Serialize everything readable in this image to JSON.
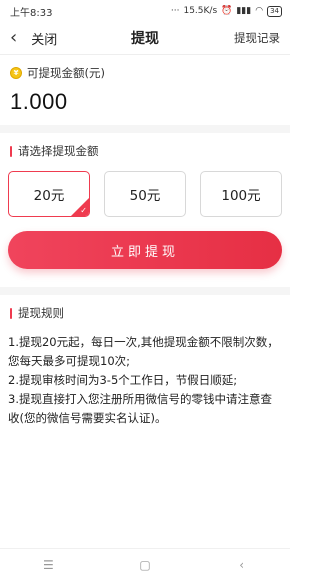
{
  "status_bar": {
    "time": "上午8:33",
    "speed": "15.5K/s",
    "battery": "34"
  },
  "nav": {
    "back_label": "关闭",
    "title": "提现",
    "right_label": "提现记录"
  },
  "amount": {
    "label": "可提现金额(元)",
    "value": "1.000"
  },
  "select": {
    "heading": "请选择提现金额",
    "options": [
      "20元",
      "50元",
      "100元"
    ],
    "selected_index": 0
  },
  "submit_label": "立即提现",
  "rules": {
    "heading": "提现规则",
    "items": [
      "1.提现20元起，每日一次,其他提现金额不限制次数，您每天最多可提现10次;",
      "2.提现审核时间为3-5个工作日，节假日顺延;",
      "3.提现直接打入您注册所用微信号的零钱中请注意查收(您的微信号需要实名认证)。"
    ]
  },
  "colors": {
    "accent": "#ef3b4f",
    "coin": "#f5c518"
  },
  "icons": {
    "back": "chevron-left-icon",
    "coin": "coin-icon",
    "check": "check-icon",
    "menu": "menu-icon",
    "home": "home-icon",
    "back_nav": "back-triangle-icon"
  }
}
